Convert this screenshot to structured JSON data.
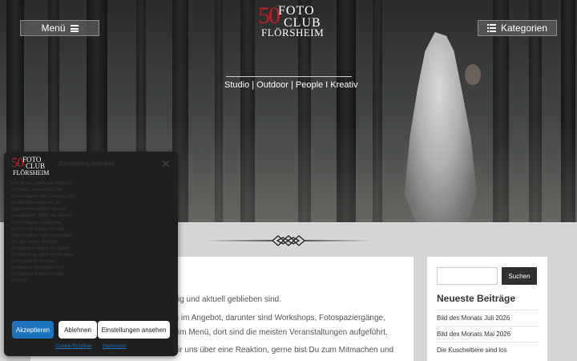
{
  "header": {
    "menu_label": "Menü",
    "categories_label": "Kategorien",
    "logo": {
      "number": "50",
      "line1": "FOTO",
      "line2": "CLUB",
      "line3": "FLÖRSHEIM"
    },
    "tagline": "Studio | Outdoor | People I Kreativ"
  },
  "main": {
    "lines": [
      "ig und aktuell geblieben sind.",
      "en im Angebot, darunter sind Workshops, Fotospaziergänge,",
      " im Menü, dort sind die meisten Veranstaltungen aufgeführt.",
      "ir uns über eine Reaktion, gerne bist Du zum Mitmachen und"
    ]
  },
  "sidebar": {
    "search_button": "Suchen",
    "search_placeholder": "",
    "recent_title": "Neueste Beiträge",
    "recent_posts": [
      "Bild des Monats Juli 2026",
      "Bild des Monats Mai 2026",
      "Die Kuscheltiere sind los"
    ]
  },
  "cookie": {
    "logo": {
      "number": "50",
      "line1": "FOTO",
      "line2": "CLUB",
      "line3": "FLÖRSHEIM"
    },
    "heading": "Zustimmung verwalten",
    "body": "Um dir ein optimales Erlebnis zu bieten, verwenden wir Technologien wie Cookies, um Geräteinformationen zu speichern und/oder darauf zuzugreifen. Wenn du diesen Technologien zustimmst, können wir Daten wie das Surfverhalten oder eindeutige IDs auf dieser Website verarbeiten. Wenn du deine Zustimmung nicht erteilst oder zurückziehst, können bestimmte Merkmale und Funktionen beeinträchtigt werden.",
    "accept": "Akzeptieren",
    "deny": "Ablehnen",
    "view": "Einstellungen ansehen",
    "link_policy": "Cookie-Richtlinie",
    "link_imprint": "Impressum"
  },
  "colors": {
    "accent": "#1e73be",
    "brand_red": "#c21d24",
    "modal_bg": "#1f1f1f"
  }
}
